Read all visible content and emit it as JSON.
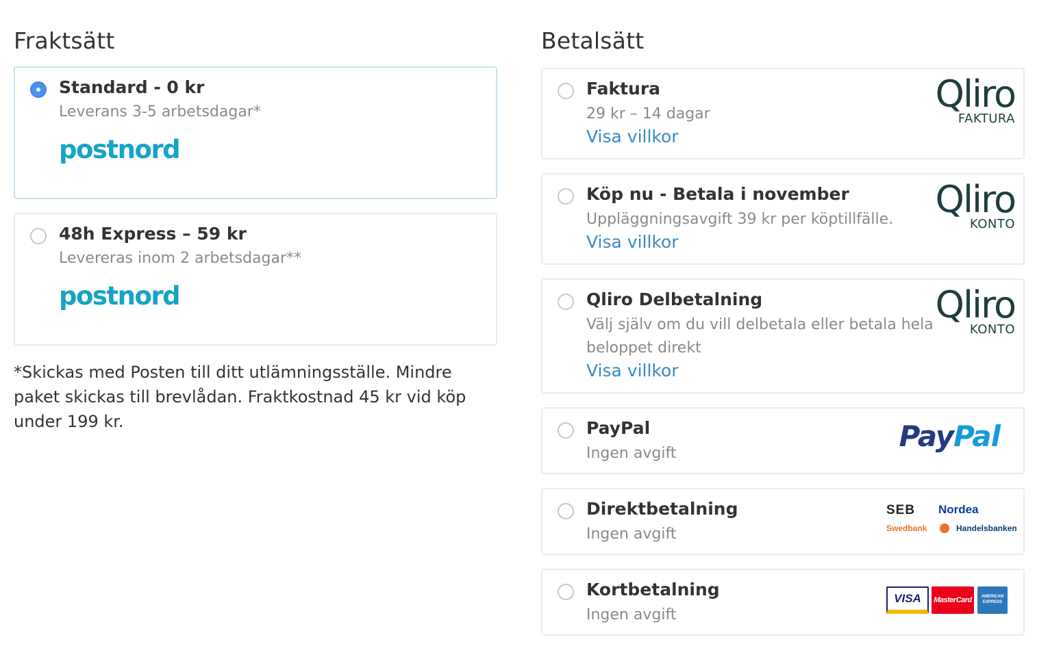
{
  "shipping": {
    "heading": "Fraktsätt",
    "options": [
      {
        "title": "Standard - 0 kr",
        "subtitle": "Leverans 3-5 arbetsdagar*",
        "logo_text": "postnord",
        "selected": true
      },
      {
        "title": "48h Express – 59 kr",
        "subtitle": "Levereras inom 2 arbetsdagar**",
        "logo_text": "postnord",
        "selected": false
      }
    ],
    "note": "*Skickas med Posten till ditt utlämningsställe. Mindre paket skickas till brevlådan. Fraktkostnad 45 kr vid köp under 199 kr."
  },
  "payment": {
    "heading": "Betalsätt",
    "options": [
      {
        "title": "Faktura",
        "subtitle": "29 kr – 14 dagar",
        "link": "Visa villkor",
        "logo_word": "Qliro",
        "logo_sub": "FAKTURA",
        "selected": false
      },
      {
        "title": "Köp nu - Betala i november",
        "subtitle": "Uppläggningsavgift 39 kr per köptillfälle.",
        "link": "Visa villkor",
        "logo_word": "Qliro",
        "logo_sub": "KONTO",
        "selected": false
      },
      {
        "title": "Qliro Delbetalning",
        "subtitle": "Välj själv om du vill delbetala eller betala hela beloppet direkt",
        "link": "Visa villkor",
        "logo_word": "Qliro",
        "logo_sub": "KONTO",
        "selected": false
      },
      {
        "title": "PayPal",
        "subtitle": "Ingen avgift",
        "logo_pay": "Pay",
        "logo_pal": "Pal",
        "selected": false
      },
      {
        "title": "Direktbetalning",
        "subtitle": "Ingen avgift",
        "banks": [
          "SEB",
          "Nordea",
          "Swedbank",
          "Handelsbanken"
        ],
        "selected": false
      },
      {
        "title": "Kortbetalning",
        "subtitle": "Ingen avgift",
        "cards": [
          "VISA",
          "MasterCard",
          "AMERICAN EXPRESS"
        ],
        "selected": false
      }
    ]
  },
  "colors": {
    "accent_link": "#3a8ac6",
    "radio_selected": "#4a94f0",
    "postnord": "#17a3c5",
    "qliro": "#1f3e3e",
    "paypal_dark": "#253b80",
    "paypal_light": "#179bd7"
  }
}
